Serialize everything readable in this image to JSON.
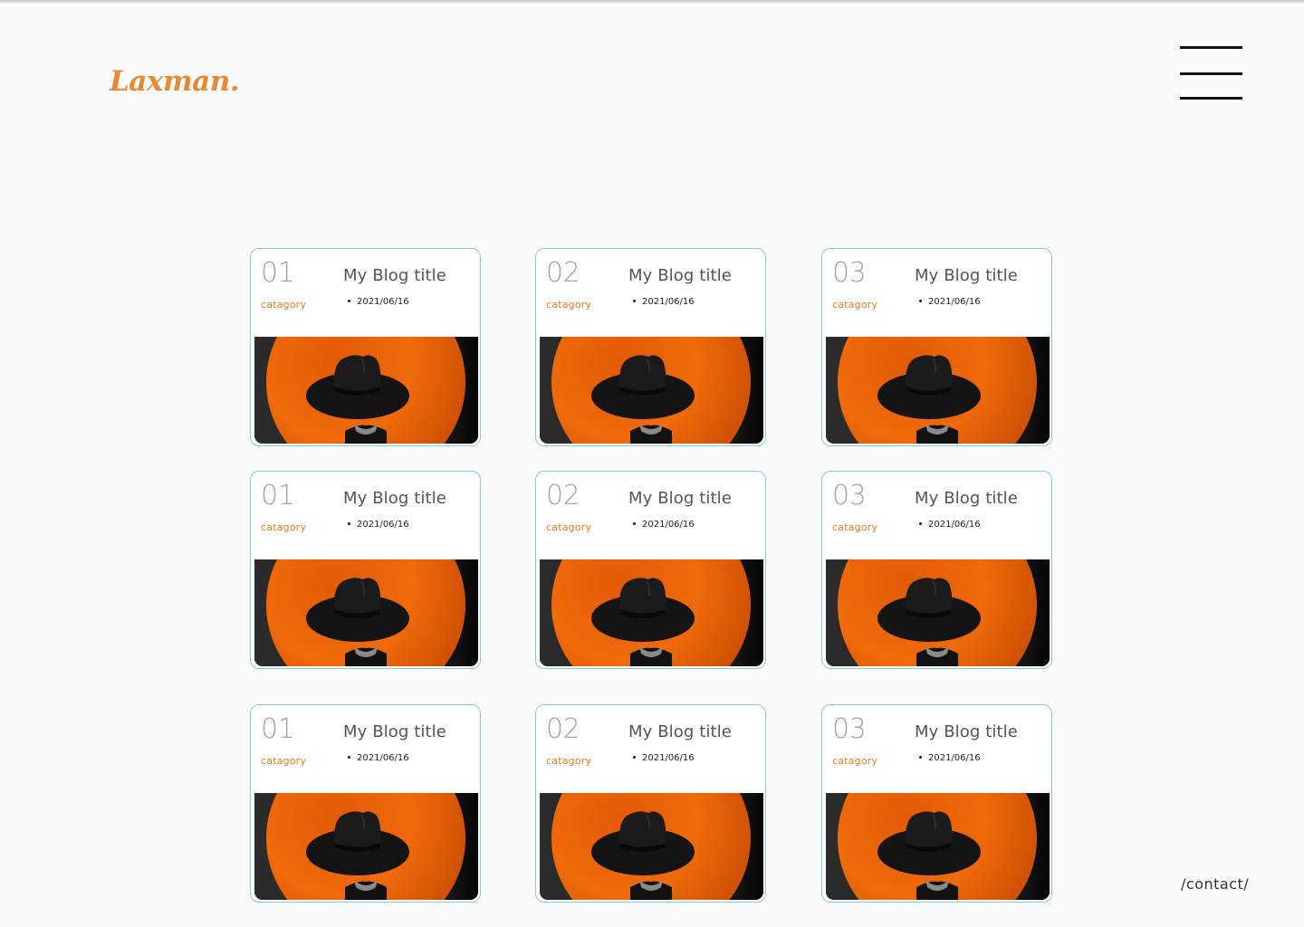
{
  "header": {
    "logo": "Laxman.",
    "menu_icon": "hamburger-menu-icon"
  },
  "colors": {
    "background": "#fbfbfb",
    "accent": "#f07a1c",
    "logo": "#e8893a",
    "card_border": "#7fcfd3",
    "number_gray": "#a3a3a3"
  },
  "posts": [
    {
      "number": "01",
      "category": "catagory",
      "title": "My Blog title",
      "date": "2021/06/16",
      "image": "orange-circle-black-hat-figure"
    },
    {
      "number": "02",
      "category": "catagory",
      "title": "My Blog title",
      "date": "2021/06/16",
      "image": "orange-circle-black-hat-figure"
    },
    {
      "number": "03",
      "category": "catagory",
      "title": "My Blog title",
      "date": "2021/06/16",
      "image": "orange-circle-black-hat-figure"
    },
    {
      "number": "01",
      "category": "catagory",
      "title": "My Blog title",
      "date": "2021/06/16",
      "image": "orange-circle-black-hat-figure"
    },
    {
      "number": "02",
      "category": "catagory",
      "title": "My Blog title",
      "date": "2021/06/16",
      "image": "orange-circle-black-hat-figure"
    },
    {
      "number": "03",
      "category": "catagory",
      "title": "My Blog title",
      "date": "2021/06/16",
      "image": "orange-circle-black-hat-figure"
    },
    {
      "number": "01",
      "category": "catagory",
      "title": "My Blog title",
      "date": "2021/06/16",
      "image": "orange-circle-black-hat-figure"
    },
    {
      "number": "02",
      "category": "catagory",
      "title": "My Blog title",
      "date": "2021/06/16",
      "image": "orange-circle-black-hat-figure"
    },
    {
      "number": "03",
      "category": "catagory",
      "title": "My Blog title",
      "date": "2021/06/16",
      "image": "orange-circle-black-hat-figure"
    }
  ],
  "footer": {
    "contact_link": "/contact/"
  }
}
